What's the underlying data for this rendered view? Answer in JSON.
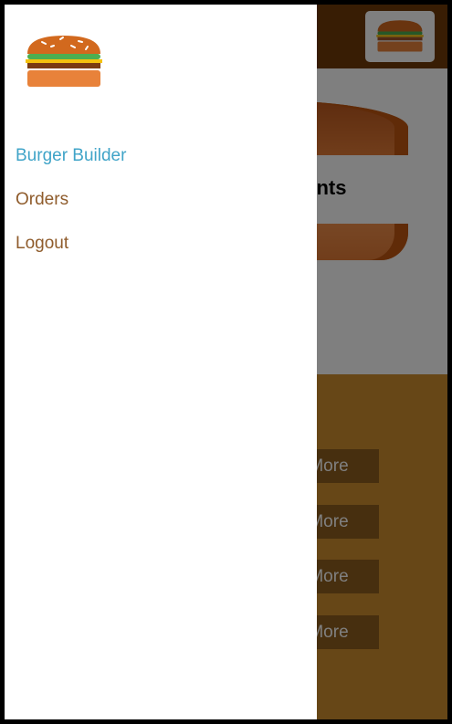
{
  "drawer": {
    "logo_icon": "burger-logo-icon",
    "nav": [
      {
        "label": "Burger Builder",
        "active": true
      },
      {
        "label": "Orders",
        "active": false
      },
      {
        "label": "Logout",
        "active": false
      }
    ]
  },
  "burger": {
    "message": "No ingredients"
  },
  "controls": {
    "more_buttons": [
      "More",
      "More",
      "More",
      "More"
    ]
  },
  "colors": {
    "toolbar": "#703b09",
    "controls_bg": "#cf8f2e",
    "nav_active": "#40a4c8",
    "nav_default": "#8f5c2c"
  }
}
